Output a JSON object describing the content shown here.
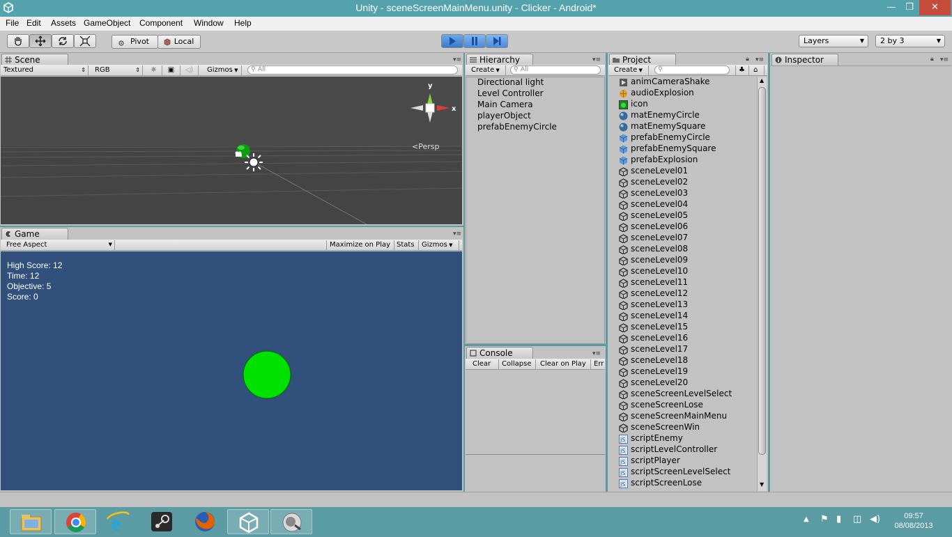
{
  "window": {
    "title": "Unity - sceneScreenMainMenu.unity - Clicker - Android*",
    "minimize": "—",
    "maximize": "❐",
    "close": "✕"
  },
  "menu": [
    "File",
    "Edit",
    "Assets",
    "GameObject",
    "Component",
    "Window",
    "Help"
  ],
  "toolbar": {
    "pivot": "Pivot",
    "local": "Local",
    "layers": "Layers",
    "layout": "2 by 3"
  },
  "scene": {
    "tab": "Scene",
    "shading": "Textured",
    "render": "RGB",
    "gizmos": "Gizmos",
    "search_placeholder": "All",
    "persp": "Persp",
    "axis_y": "y",
    "axis_x": "x"
  },
  "game": {
    "tab": "Game",
    "aspect": "Free Aspect",
    "maximize": "Maximize on Play",
    "stats": "Stats",
    "gizmos": "Gizmos",
    "hud": [
      "High Score: 12",
      "Time: 12",
      "Objective: 5",
      "Score: 0"
    ]
  },
  "hierarchy": {
    "tab": "Hierarchy",
    "create": "Create",
    "search_placeholder": "All",
    "items": [
      "Directional light",
      "Level Controller",
      "Main Camera",
      "playerObject",
      "prefabEnemyCircle"
    ]
  },
  "console": {
    "tab": "Console",
    "clear": "Clear",
    "collapse": "Collapse",
    "clear_on_play": "Clear on Play",
    "error_pause": "Err"
  },
  "project": {
    "tab": "Project",
    "create": "Create",
    "items": [
      {
        "name": "animCameraShake",
        "icon": "animation-icon"
      },
      {
        "name": "audioExplosion",
        "icon": "audio-icon"
      },
      {
        "name": "icon",
        "icon": "texture-icon"
      },
      {
        "name": "matEnemyCircle",
        "icon": "material-icon"
      },
      {
        "name": "matEnemySquare",
        "icon": "material-icon"
      },
      {
        "name": "prefabEnemyCircle",
        "icon": "prefab-icon"
      },
      {
        "name": "prefabEnemySquare",
        "icon": "prefab-icon"
      },
      {
        "name": "prefabExplosion",
        "icon": "prefab-icon"
      },
      {
        "name": "sceneLevel01",
        "icon": "scene-icon"
      },
      {
        "name": "sceneLevel02",
        "icon": "scene-icon"
      },
      {
        "name": "sceneLevel03",
        "icon": "scene-icon"
      },
      {
        "name": "sceneLevel04",
        "icon": "scene-icon"
      },
      {
        "name": "sceneLevel05",
        "icon": "scene-icon"
      },
      {
        "name": "sceneLevel06",
        "icon": "scene-icon"
      },
      {
        "name": "sceneLevel07",
        "icon": "scene-icon"
      },
      {
        "name": "sceneLevel08",
        "icon": "scene-icon"
      },
      {
        "name": "sceneLevel09",
        "icon": "scene-icon"
      },
      {
        "name": "sceneLevel10",
        "icon": "scene-icon"
      },
      {
        "name": "sceneLevel11",
        "icon": "scene-icon"
      },
      {
        "name": "sceneLevel12",
        "icon": "scene-icon"
      },
      {
        "name": "sceneLevel13",
        "icon": "scene-icon"
      },
      {
        "name": "sceneLevel14",
        "icon": "scene-icon"
      },
      {
        "name": "sceneLevel15",
        "icon": "scene-icon"
      },
      {
        "name": "sceneLevel16",
        "icon": "scene-icon"
      },
      {
        "name": "sceneLevel17",
        "icon": "scene-icon"
      },
      {
        "name": "sceneLevel18",
        "icon": "scene-icon"
      },
      {
        "name": "sceneLevel19",
        "icon": "scene-icon"
      },
      {
        "name": "sceneLevel20",
        "icon": "scene-icon"
      },
      {
        "name": "sceneScreenLevelSelect",
        "icon": "scene-icon"
      },
      {
        "name": "sceneScreenLose",
        "icon": "scene-icon"
      },
      {
        "name": "sceneScreenMainMenu",
        "icon": "scene-icon"
      },
      {
        "name": "sceneScreenWin",
        "icon": "scene-icon"
      },
      {
        "name": "scriptEnemy",
        "icon": "script-icon"
      },
      {
        "name": "scriptLevelController",
        "icon": "script-icon"
      },
      {
        "name": "scriptPlayer",
        "icon": "script-icon"
      },
      {
        "name": "scriptScreenLevelSelect",
        "icon": "script-icon"
      },
      {
        "name": "scriptScreenLose",
        "icon": "script-icon"
      }
    ]
  },
  "inspector": {
    "tab": "Inspector"
  },
  "taskbar": {
    "apps": [
      "file-explorer-icon",
      "chrome-icon",
      "internet-explorer-icon",
      "steam-icon",
      "firefox-icon",
      "unity-icon",
      "monodevelop-icon"
    ],
    "time": "09:57",
    "date": "08/08/2013"
  },
  "colors": {
    "title_bar": "#54a2ab",
    "taskbar": "#5b9ba4",
    "game_bg": "#31507c",
    "scene_bg": "#474747",
    "play_accent": "#3b78c8",
    "ball": "#00dd00"
  }
}
